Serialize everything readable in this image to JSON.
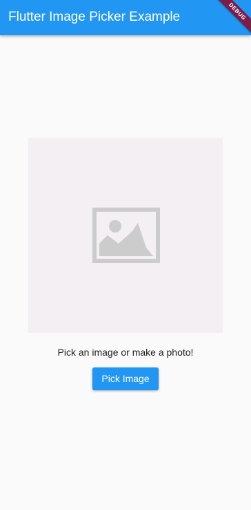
{
  "app_bar": {
    "title": "Flutter Image Picker Example",
    "background_color": "#2196f3"
  },
  "debug_banner": {
    "label": "DEBUG",
    "color": "#7a1d4a"
  },
  "main": {
    "image_placeholder": {
      "icon": "image-placeholder-icon",
      "background_color": "#f3eff3",
      "icon_color": "#cccccc"
    },
    "caption": "Pick an image or make a photo!",
    "pick_button_label": "Pick Image"
  }
}
